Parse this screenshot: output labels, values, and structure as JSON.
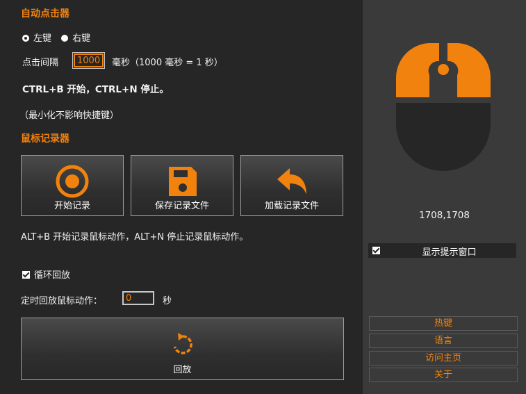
{
  "autoclicker": {
    "title": "自动点击器",
    "radio_left": "左键",
    "radio_right": "右键",
    "interval_label": "点击间隔",
    "interval_value": "1000",
    "interval_unit": "毫秒（1000 毫秒 = 1 秒）",
    "hotkey_text": "CTRL+B 开始，CTRL+N 停止。",
    "minimize_note": "（最小化不影响快捷键）"
  },
  "recorder": {
    "title": "鼠标记录器",
    "buttons": [
      {
        "label": "开始记录",
        "icon": "record-icon"
      },
      {
        "label": "保存记录文件",
        "icon": "floppy-disk-icon"
      },
      {
        "label": "加载记录文件",
        "icon": "reply-arrow-icon"
      }
    ],
    "hotkey_text": "ALT+B 开始记录鼠标动作，ALT+N 停止记录鼠标动作。",
    "loop_label": "循环回放",
    "timer_label": "定时回放鼠标动作：",
    "timer_value": "0",
    "timer_unit": "秒",
    "replay_label": "回放"
  },
  "side": {
    "coords": "1708,1708",
    "show_tip_label": "显示提示窗口",
    "links": [
      "热键",
      "语言",
      "访问主页",
      "关于"
    ]
  },
  "colors": {
    "accent": "#f2820e",
    "panel_bg": "#262626",
    "side_bg": "#3a3a3a"
  }
}
